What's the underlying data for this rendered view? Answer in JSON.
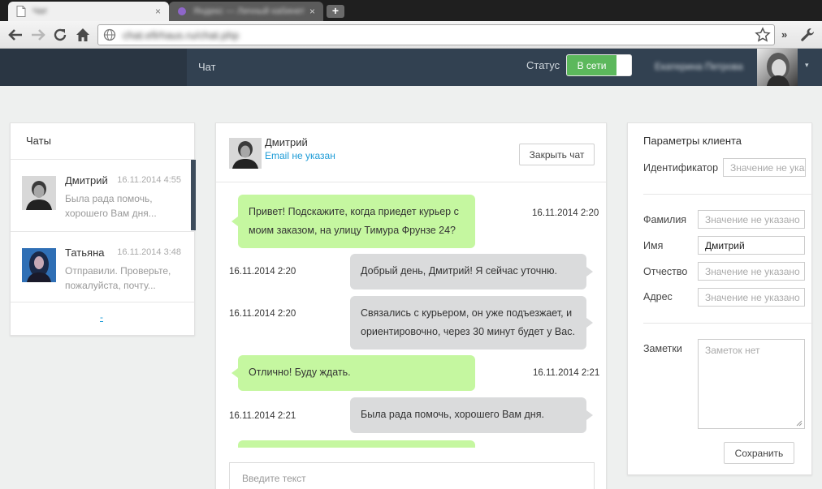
{
  "browser": {
    "tabs": [
      {
        "title": "Чат"
      },
      {
        "title": "Яндекс — Личный кабинет"
      }
    ],
    "new_tab_label": "+",
    "close_tab_label": "×",
    "url": "chat.efirhaus.ru/chat.php",
    "menu_chevron_label": "»"
  },
  "header": {
    "nav_chat": "Чат",
    "status_label": "Статус",
    "status_value": "В сети",
    "user_name": "Екатерина Петрова",
    "user_caret": "▾"
  },
  "chats": {
    "title": "Чаты",
    "items": [
      {
        "name": "Дмитрий",
        "time": "16.11.2014 4:55",
        "preview": "Была рада помочь, хорошего Вам дня..."
      },
      {
        "name": "Татьяна",
        "time": "16.11.2014 3:48",
        "preview": "Отправили. Проверьте, пожалуйста, почту..."
      }
    ],
    "more_label": "-"
  },
  "conversation": {
    "name": "Дмитрий",
    "email": "Email не указан",
    "close_label": "Закрыть чат",
    "input_placeholder": "Введите текст",
    "messages": [
      {
        "from": "client",
        "text1": "Привет! Подскажите, когда приедет курьер с",
        "text2": "моим заказом, на улицу Тимура Фрунзе 24?",
        "time": "16.11.2014 2:20"
      },
      {
        "from": "operator",
        "text1": "Добрый день, Дмитрий! Я сейчас уточню.",
        "time": "16.11.2014 2:20"
      },
      {
        "from": "operator",
        "text1": "Связались с курьером, он уже подъезжает, и",
        "text2": "ориентировочно, через 30 минут будет у Вас.",
        "time": "16.11.2014 2:20"
      },
      {
        "from": "client",
        "text1": "Отлично! Буду ждать.",
        "time": "16.11.2014 2:21"
      },
      {
        "from": "operator",
        "text1": "Была рада помочь, хорошего Вам дня.",
        "time": "16.11.2014 2:21"
      }
    ]
  },
  "client_params": {
    "title": "Параметры клиента",
    "id_label": "Идентификатор",
    "id_placeholder": "Значение не указано",
    "surname_label": "Фамилия",
    "surname_placeholder": "Значение не указано",
    "name_label": "Имя",
    "name_value": "Дмитрий",
    "patronymic_label": "Отчество",
    "patronymic_placeholder": "Значение не указано",
    "address_label": "Адрес",
    "address_placeholder": "Значение не указано",
    "notes_label": "Заметки",
    "notes_placeholder": "Заметок нет",
    "save_label": "Сохранить"
  },
  "colors": {
    "header_bg": "#324151",
    "online_green": "#5cb85c",
    "client_bubble": "#c5f7a0",
    "operator_bubble": "#dadbdc",
    "link_blue": "#1e9cd7"
  }
}
